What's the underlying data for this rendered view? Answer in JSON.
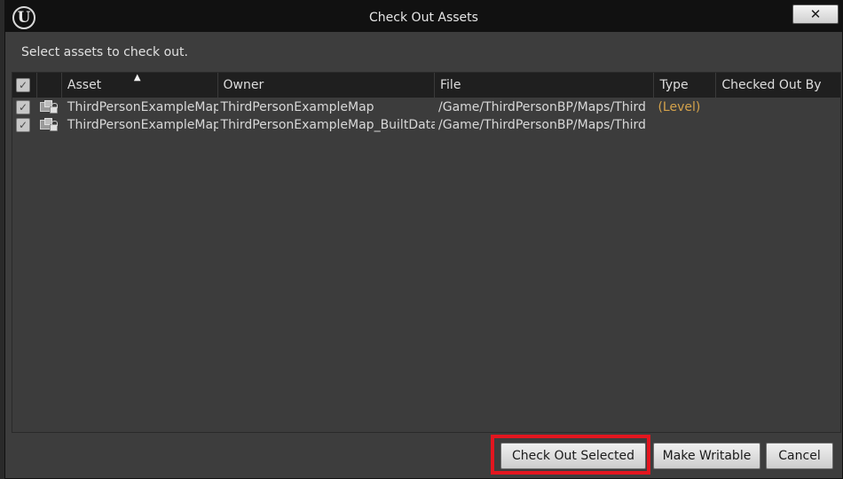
{
  "window": {
    "title": "Check Out Assets",
    "close_icon": "close-icon",
    "logo_text": "U"
  },
  "prompt": "Select assets to check out.",
  "table": {
    "columns": [
      "Asset",
      "Owner",
      "File",
      "Type",
      "Checked Out By"
    ],
    "sort_column": "Asset",
    "rows": [
      {
        "checked": true,
        "asset": "ThirdPersonExampleMap",
        "owner": "ThirdPersonExampleMap",
        "file": "/Game/ThirdPersonBP/Maps/Third",
        "type": "(Level)",
        "checked_out_by": ""
      },
      {
        "checked": true,
        "asset": "ThirdPersonExampleMap",
        "owner": "ThirdPersonExampleMap_BuiltData",
        "file": "/Game/ThirdPersonBP/Maps/Third",
        "type": "",
        "checked_out_by": ""
      }
    ]
  },
  "buttons": {
    "check_out_selected": "Check Out Selected",
    "make_writable": "Make Writable",
    "cancel": "Cancel"
  },
  "colors": {
    "type_level": "#d4a24b",
    "highlight": "#e3161f"
  }
}
